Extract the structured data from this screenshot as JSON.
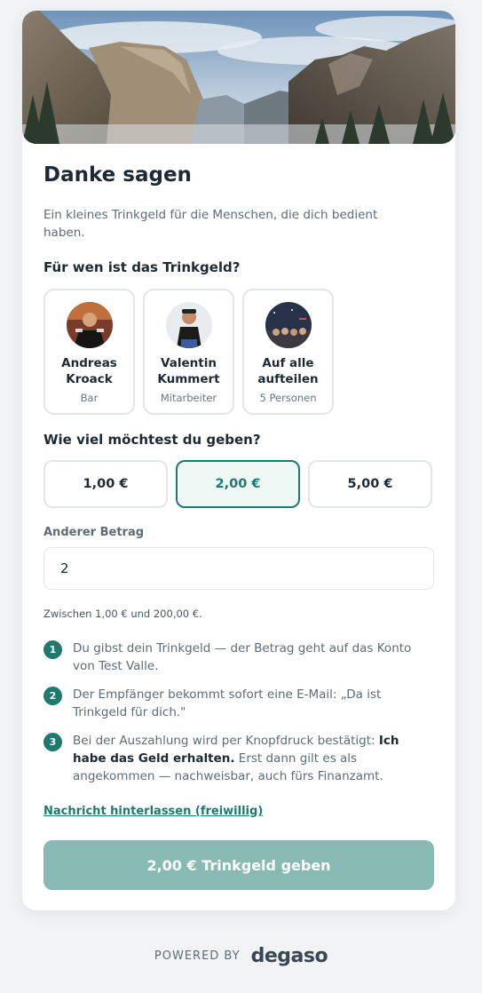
{
  "card": {
    "title": "Danke sagen",
    "subtitle": "Ein kleines Trinkgeld für die Menschen, die dich bedient haben."
  },
  "recipients": {
    "heading": "Für wen ist das Trinkgeld?",
    "items": [
      {
        "name": "Andreas\nKroack",
        "role": "Bar"
      },
      {
        "name": "Valentin\nKummert",
        "role": "Mitarbeiter"
      },
      {
        "name": "Auf alle\naufteilen",
        "role": "5 Personen"
      }
    ]
  },
  "amounts": {
    "heading": "Wie viel möchtest du geben?",
    "options": [
      "1,00 €",
      "2,00 €",
      "5,00 €"
    ],
    "selected": "2,00 €"
  },
  "custom_amount": {
    "label": "Anderer Betrag",
    "value": "2",
    "hint": "Zwischen 1,00 € und 200,00 €."
  },
  "steps": [
    {
      "number": "1",
      "text": "Du gibst dein Trinkgeld — der Betrag geht auf das Konto von Test Valle."
    },
    {
      "number": "2",
      "text": "Der Empfänger bekommt sofort eine E-Mail: „Da ist Trinkgeld für dich.\""
    },
    {
      "number": "3",
      "text_before": "Bei der Auszahlung wird per Knopfdruck bestätigt: ",
      "text_bold": "Ich habe das Geld erhalten.",
      "text_after": " Erst dann gilt es als angekommen — nachweisbar, auch fürs Finanzamt."
    }
  ],
  "message_link": "Nachricht hinterlassen (freiwillig)",
  "submit_label": "2,00 € Trinkgeld geben",
  "footer": {
    "powered_by": "POWERED BY",
    "brand": "degaso"
  },
  "colors": {
    "accent": "#1f7a6d",
    "accent_light": "#eef9f6",
    "submit_bg": "#88b9b2",
    "page_bg": "#f1f3f5"
  }
}
